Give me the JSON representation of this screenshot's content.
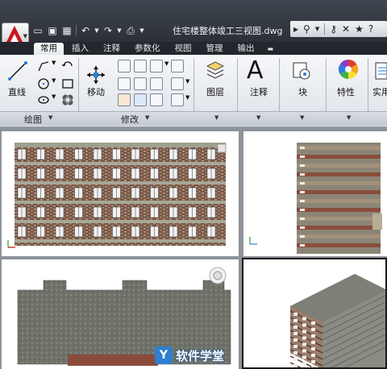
{
  "title_bar": {
    "document_title": "住宅楼整体竣工三视图.dwg",
    "app_menu_icon": "autocad-logo-icon",
    "quick_access": [
      "new-icon",
      "open-icon",
      "save-icon",
      "undo-icon",
      "redo-icon",
      "plot-icon"
    ],
    "right_tools": [
      "binoculars-icon",
      "key-icon",
      "exchange-icon",
      "star-icon",
      "help-icon"
    ]
  },
  "ribbon": {
    "tabs": [
      {
        "label": "常用",
        "active": true
      },
      {
        "label": "插入",
        "active": false
      },
      {
        "label": "注释",
        "active": false
      },
      {
        "label": "参数化",
        "active": false
      },
      {
        "label": "视图",
        "active": false
      },
      {
        "label": "管理",
        "active": false
      },
      {
        "label": "输出",
        "active": false
      },
      {
        "label": "▬",
        "active": false
      }
    ],
    "draw": {
      "line_label": "直线",
      "panel_title": "绘图"
    },
    "modify": {
      "move_label": "移动",
      "panel_title": "修改"
    },
    "layers_label": "图层",
    "annotation_label": "注释",
    "block_label": "块",
    "properties_label": "特性",
    "utilities_label": "实用"
  },
  "viewports": {
    "front": {
      "label": "front-view"
    },
    "side": {
      "label": "side-view"
    },
    "top": {
      "label": "top-view"
    },
    "iso": {
      "label": "isometric-view"
    }
  },
  "watermark": {
    "text": "软件学堂"
  },
  "colors": {
    "accent": "#c8161d",
    "ribbon_bg": "#e8ebef",
    "viewport_border": "#1a1a1a"
  }
}
